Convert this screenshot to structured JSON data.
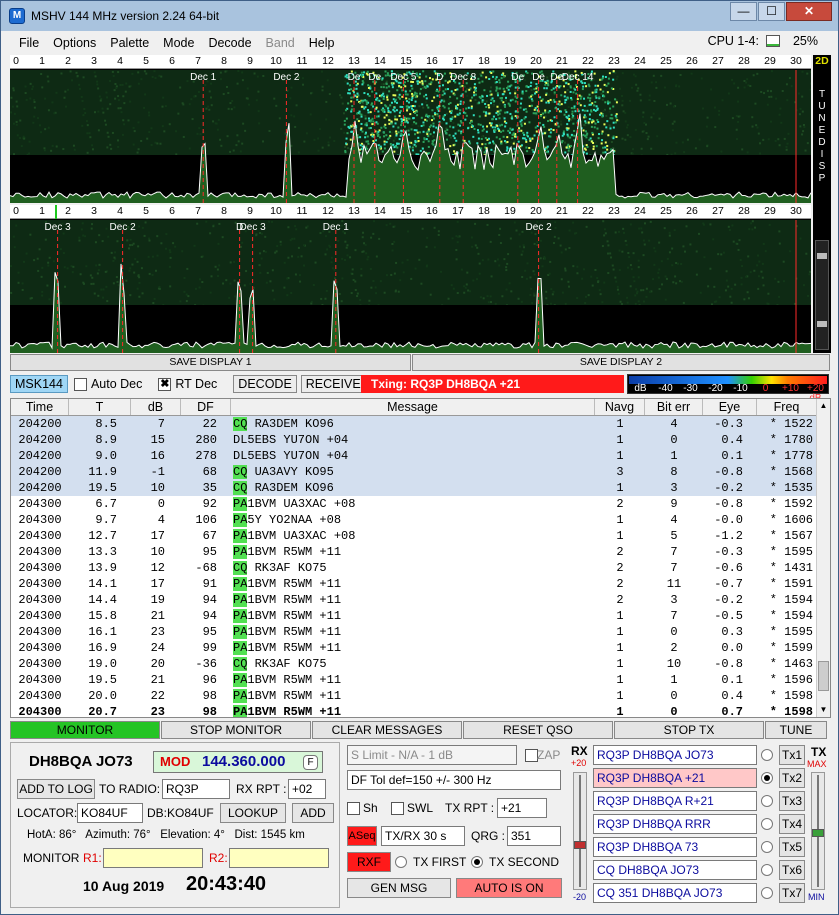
{
  "window": {
    "title": "MSHV 144 MHz version 2.24 64-bit",
    "app_icon": "M",
    "min": "—",
    "max": "☐",
    "close": "✕"
  },
  "menu": [
    "File",
    "Options",
    "Palette",
    "Mode",
    "Decode",
    "Band",
    "Help"
  ],
  "menu_disabled": [
    "Band"
  ],
  "cpu": {
    "label": "CPU 1-4:",
    "value": "25%",
    "fraction": 0.25
  },
  "waterfall_top": {
    "scale": [
      "0",
      "1",
      "2",
      "3",
      "4",
      "5",
      "6",
      "7",
      "8",
      "9",
      "10",
      "11",
      "12",
      "13",
      "14",
      "15",
      "16",
      "17",
      "18",
      "19",
      "20",
      "21",
      "22",
      "23",
      "24",
      "25",
      "26",
      "27",
      "28",
      "29",
      "30"
    ],
    "decodes": [
      {
        "label": "Dec 1",
        "at": 7.2
      },
      {
        "label": "Dec 2",
        "at": 10.4
      },
      {
        "label": "De",
        "at": 13.0
      },
      {
        "label": "De",
        "at": 13.8
      },
      {
        "label": "Dec 5",
        "at": 14.9
      },
      {
        "label": "D",
        "at": 16.3
      },
      {
        "label": "Dec 8",
        "at": 17.2
      },
      {
        "label": "De",
        "at": 19.3
      },
      {
        "label": "De",
        "at": 20.1
      },
      {
        "label": "De",
        "at": 20.8
      },
      {
        "label": "Dec 14",
        "at": 21.6
      }
    ]
  },
  "waterfall_bottom": {
    "scale": [
      "0",
      "1",
      "2",
      "3",
      "4",
      "5",
      "6",
      "7",
      "8",
      "9",
      "10",
      "11",
      "12",
      "13",
      "14",
      "15",
      "16",
      "17",
      "18",
      "19",
      "20",
      "21",
      "22",
      "23",
      "24",
      "25",
      "26",
      "27",
      "28",
      "29",
      "30"
    ],
    "decodes": [
      {
        "label": "Dec 3",
        "at": 1.6
      },
      {
        "label": "Dec 2",
        "at": 4.1
      },
      {
        "label": "D",
        "at": 8.6
      },
      {
        "label": "Dec 3",
        "at": 9.1
      },
      {
        "label": "Dec 1",
        "at": 12.3
      },
      {
        "label": "Dec 2",
        "at": 20.1
      }
    ]
  },
  "sidebar": {
    "mode2d": "2D",
    "tune": "TUNE",
    "disp": "DISP"
  },
  "save1": "SAVE DISPLAY 1",
  "save2": "SAVE DISPLAY 2",
  "controls": {
    "mode": "MSK144",
    "auto_dec": "Auto Dec",
    "auto_dec_checked": false,
    "rt_dec": "RT Dec",
    "rt_dec_checked": true,
    "decode": "DECODE",
    "receive": "RECEIVE",
    "txing": "Txing: RQ3P DH8BQA +21",
    "db_scale": [
      "dB",
      "-40",
      "-30",
      "-20",
      "-10",
      "0",
      "+10",
      "+20 dB"
    ]
  },
  "table": {
    "headers": [
      "Time",
      "T",
      "dB",
      "DF",
      "Message",
      "Navg",
      "Bit err",
      "Eye",
      "Freq"
    ],
    "rows": [
      {
        "time": "204200",
        "t": "8.5",
        "db": "7",
        "df": "22",
        "pfx": "CQ",
        "msg": " RA3DEM KO96",
        "navg": "1",
        "bit": "4",
        "eye": "-0.3",
        "freq": "* 1522",
        "hl": true
      },
      {
        "time": "204200",
        "t": "8.9",
        "db": "15",
        "df": "280",
        "pfx": "",
        "msg": "DL5EBS YU7ON +04",
        "navg": "1",
        "bit": "0",
        "eye": "0.4",
        "freq": "* 1780",
        "hl": true
      },
      {
        "time": "204200",
        "t": "9.0",
        "db": "16",
        "df": "278",
        "pfx": "",
        "msg": "DL5EBS YU7ON +04",
        "navg": "1",
        "bit": "1",
        "eye": "0.1",
        "freq": "* 1778",
        "hl": true
      },
      {
        "time": "204200",
        "t": "11.9",
        "db": "-1",
        "df": "68",
        "pfx": "CQ",
        "msg": " UA3AVY KO95",
        "navg": "3",
        "bit": "8",
        "eye": "-0.8",
        "freq": "* 1568",
        "hl": true
      },
      {
        "time": "204200",
        "t": "19.5",
        "db": "10",
        "df": "35",
        "pfx": "CQ",
        "msg": " RA3DEM KO96",
        "navg": "1",
        "bit": "3",
        "eye": "-0.2",
        "freq": "* 1535",
        "hl": true
      },
      {
        "time": "204300",
        "t": "6.7",
        "db": "0",
        "df": "92",
        "pfx": "PA",
        "msg": "1BVM UA3XAC +08",
        "navg": "2",
        "bit": "9",
        "eye": "-0.8",
        "freq": "* 1592",
        "hl": false
      },
      {
        "time": "204300",
        "t": "9.7",
        "db": "4",
        "df": "106",
        "pfx": "PA",
        "msg": "5Y YO2NAA +08",
        "navg": "1",
        "bit": "4",
        "eye": "-0.0",
        "freq": "* 1606",
        "hl": false
      },
      {
        "time": "204300",
        "t": "12.7",
        "db": "17",
        "df": "67",
        "pfx": "PA",
        "msg": "1BVM UA3XAC +08",
        "navg": "1",
        "bit": "5",
        "eye": "-1.2",
        "freq": "* 1567",
        "hl": false
      },
      {
        "time": "204300",
        "t": "13.3",
        "db": "10",
        "df": "95",
        "pfx": "PA",
        "msg": "1BVM R5WM +11",
        "navg": "2",
        "bit": "7",
        "eye": "-0.3",
        "freq": "* 1595",
        "hl": false
      },
      {
        "time": "204300",
        "t": "13.9",
        "db": "12",
        "df": "-68",
        "pfx": "CQ",
        "msg": " RK3AF KO75",
        "navg": "2",
        "bit": "7",
        "eye": "-0.6",
        "freq": "* 1431",
        "hl": false
      },
      {
        "time": "204300",
        "t": "14.1",
        "db": "17",
        "df": "91",
        "pfx": "PA",
        "msg": "1BVM R5WM +11",
        "navg": "2",
        "bit": "11",
        "eye": "-0.7",
        "freq": "* 1591",
        "hl": false
      },
      {
        "time": "204300",
        "t": "14.4",
        "db": "19",
        "df": "94",
        "pfx": "PA",
        "msg": "1BVM R5WM +11",
        "navg": "2",
        "bit": "3",
        "eye": "-0.2",
        "freq": "* 1594",
        "hl": false
      },
      {
        "time": "204300",
        "t": "15.8",
        "db": "21",
        "df": "94",
        "pfx": "PA",
        "msg": "1BVM R5WM +11",
        "navg": "1",
        "bit": "7",
        "eye": "-0.5",
        "freq": "* 1594",
        "hl": false
      },
      {
        "time": "204300",
        "t": "16.1",
        "db": "23",
        "df": "95",
        "pfx": "PA",
        "msg": "1BVM R5WM +11",
        "navg": "1",
        "bit": "0",
        "eye": "0.3",
        "freq": "* 1595",
        "hl": false
      },
      {
        "time": "204300",
        "t": "16.9",
        "db": "24",
        "df": "99",
        "pfx": "PA",
        "msg": "1BVM R5WM +11",
        "navg": "1",
        "bit": "2",
        "eye": "0.0",
        "freq": "* 1599",
        "hl": false
      },
      {
        "time": "204300",
        "t": "19.0",
        "db": "20",
        "df": "-36",
        "pfx": "CQ",
        "msg": " RK3AF KO75",
        "navg": "1",
        "bit": "10",
        "eye": "-0.8",
        "freq": "* 1463",
        "hl": false
      },
      {
        "time": "204300",
        "t": "19.5",
        "db": "21",
        "df": "96",
        "pfx": "PA",
        "msg": "1BVM R5WM +11",
        "navg": "1",
        "bit": "1",
        "eye": "0.1",
        "freq": "* 1596",
        "hl": false
      },
      {
        "time": "204300",
        "t": "20.0",
        "db": "22",
        "df": "98",
        "pfx": "PA",
        "msg": "1BVM R5WM +11",
        "navg": "1",
        "bit": "0",
        "eye": "0.4",
        "freq": "* 1598",
        "hl": false
      },
      {
        "time": "204300",
        "t": "20.7",
        "db": "23",
        "df": "98",
        "pfx": "PA",
        "msg": "1BVM R5WM +11",
        "navg": "1",
        "bit": "0",
        "eye": "0.7",
        "freq": "* 1598",
        "hl": false,
        "bold": true
      }
    ]
  },
  "buttons": {
    "monitor": "MONITOR",
    "stop_monitor": "STOP MONITOR",
    "clear": "CLEAR MESSAGES",
    "reset_qso": "RESET QSO",
    "stop_tx": "STOP TX",
    "tune": "TUNE"
  },
  "left": {
    "my_call": "DH8BQA JO73",
    "mod": "MOD",
    "freq": "144.360.000",
    "f": "F",
    "add_log": "ADD TO LOG",
    "to_radio_lbl": "TO RADIO:",
    "to_radio": "RQ3P",
    "rx_rpt_lbl": "RX RPT :",
    "rx_rpt": "+02",
    "locator_lbl": "LOCATOR:",
    "locator": "KO84UF",
    "db_loc": "DB:KO84UF",
    "lookup": "LOOKUP",
    "add": "ADD",
    "info": "HotA: 86°   Azimuth: 76°   Elevation: 4°   Dist: 1545 km",
    "monitor_lbl": "MONITOR",
    "r1": "R1:",
    "r2": "R2:",
    "date": "10 Aug 2019",
    "time": "20:43:40"
  },
  "mid": {
    "slimit": "S Limit - N/A - 1 dB",
    "zap": "ZAP",
    "dftol": "DF Tol def=150 +/-  300  Hz",
    "sh": "Sh",
    "swl": "SWL",
    "tx_rpt_lbl": "TX RPT :",
    "tx_rpt": "+21",
    "aseq": "ASeq",
    "txrx": "TX/RX 30  s",
    "qrg_lbl": "QRG :",
    "qrg": "351",
    "rxf": "RXF",
    "tx_first": "TX FIRST",
    "tx_second": "TX SECOND",
    "tx_second_on": true,
    "gen_msg": "GEN MSG",
    "auto_on": "AUTO IS ON"
  },
  "right": {
    "rx_lbl": "RX",
    "rx_top": "+20",
    "rx_bot": "-20",
    "tx_lbl": "TX",
    "tx_max": "MAX",
    "tx_min": "MIN",
    "tx_msgs": [
      {
        "text": "RQ3P DH8BQA JO73",
        "btn": "Tx1",
        "sel": false
      },
      {
        "text": "RQ3P DH8BQA +21",
        "btn": "Tx2",
        "sel": true
      },
      {
        "text": "RQ3P DH8BQA R+21",
        "btn": "Tx3",
        "sel": false
      },
      {
        "text": "RQ3P DH8BQA RRR",
        "btn": "Tx4",
        "sel": false
      },
      {
        "text": "RQ3P DH8BQA 73",
        "btn": "Tx5",
        "sel": false
      },
      {
        "text": "CQ DH8BQA JO73",
        "btn": "Tx6",
        "sel": false
      },
      {
        "text": "CQ 351 DH8BQA JO73",
        "btn": "Tx7",
        "sel": false
      }
    ]
  },
  "colors": {
    "accent_green": "#25c425",
    "txing_red": "#ff1a1a",
    "highlight_row": "#d3dfef",
    "msg_prefix_green": "#52e052"
  }
}
